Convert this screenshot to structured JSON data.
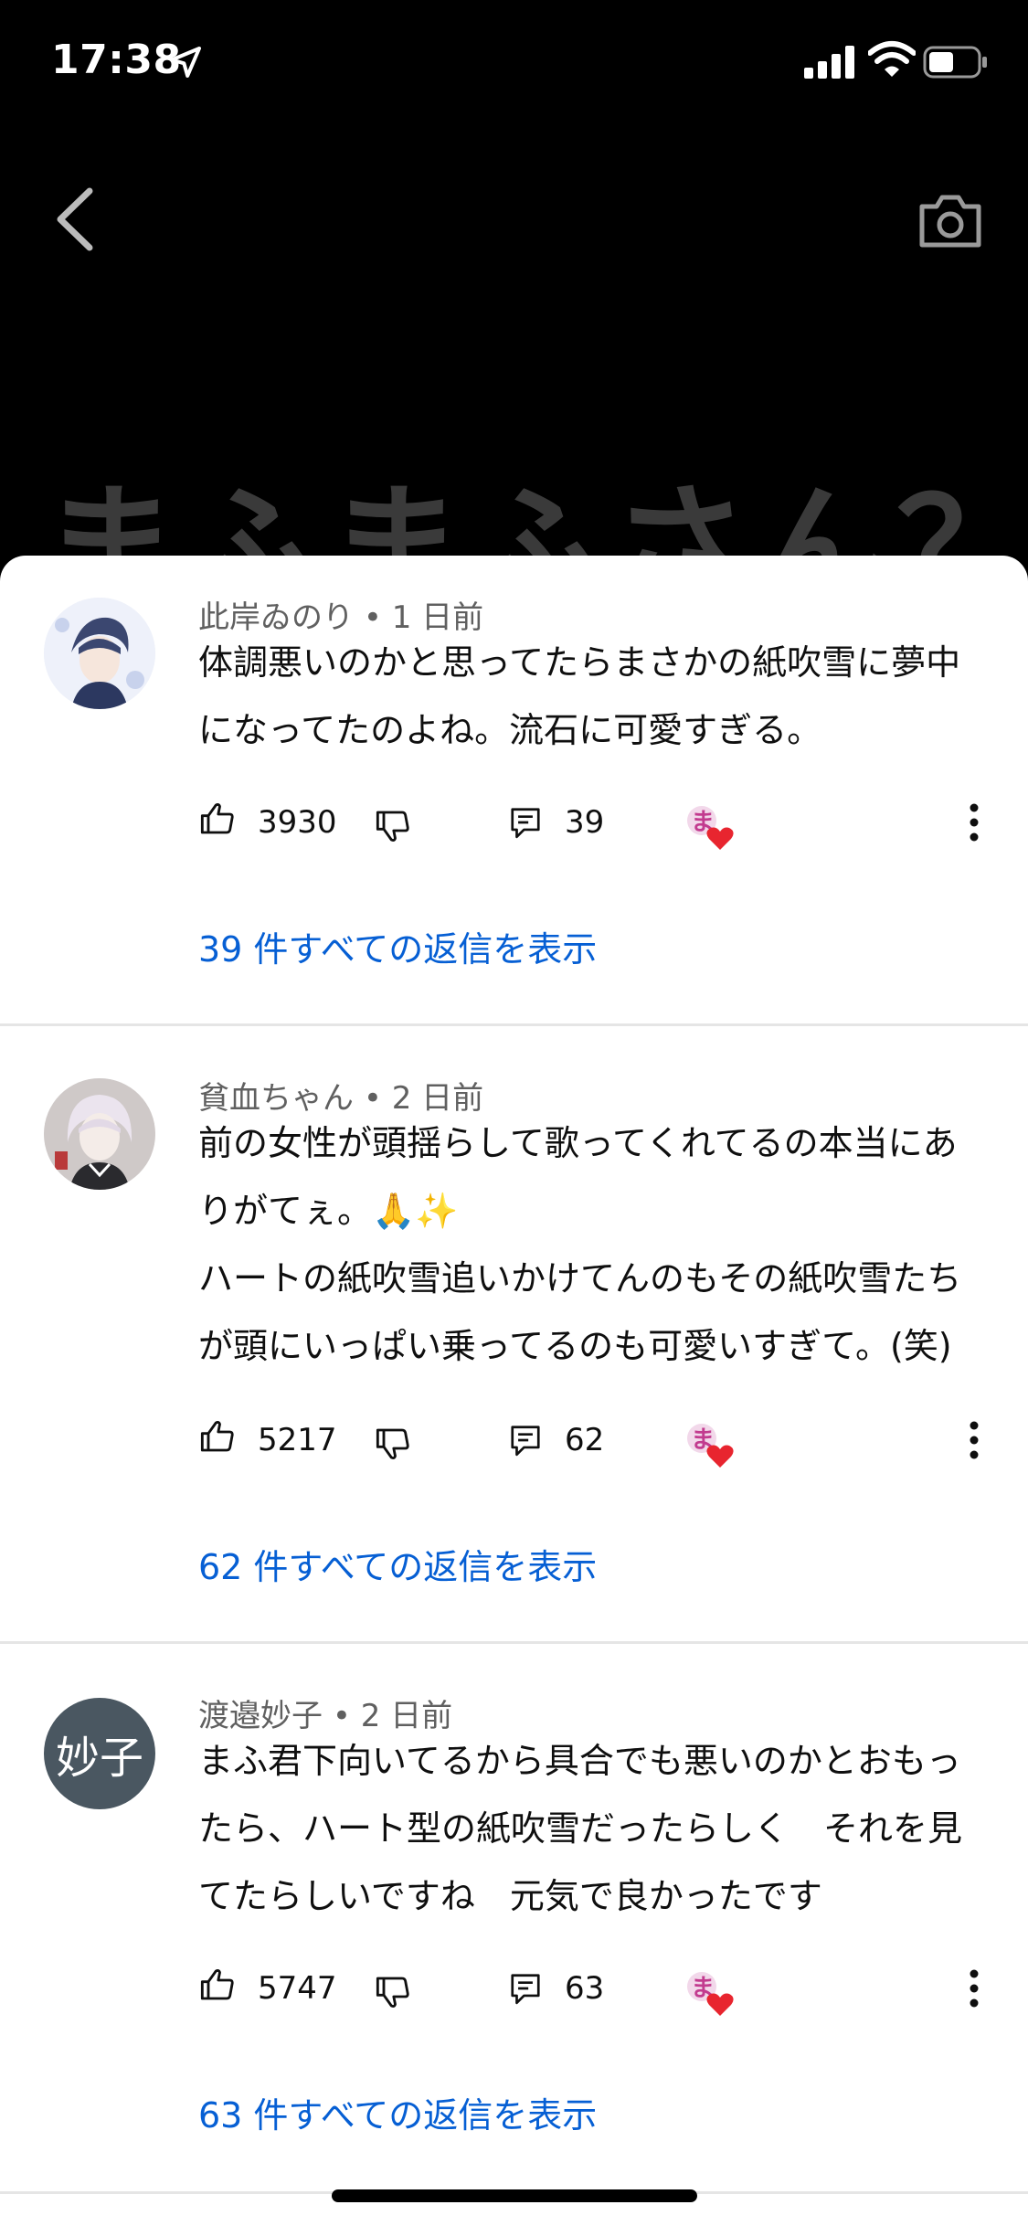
{
  "status_bar": {
    "time": "17:38"
  },
  "background_title": "まふまふさん？",
  "comments": [
    {
      "author": "此岸ゐのり",
      "age": "1 日前",
      "text": "体調悪いのかと思ってたらまさかの紙吹雪に夢中\nになってたのよね。流石に可愛すぎる。",
      "likes": "3930",
      "reply_count": "39",
      "replies_label": "39 件すべての返信を表示"
    },
    {
      "author": "貧血ちゃん",
      "age": "2 日前",
      "text": "前の女性が頭揺らして歌ってくれてるの本当にあ\nりがてぇ。🙏✨\nハートの紙吹雪追いかけてんのもその紙吹雪たち\nが頭にいっぱい乗ってるのも可愛いすぎて。(笑)",
      "likes": "5217",
      "reply_count": "62",
      "replies_label": "62 件すべての返信を表示"
    },
    {
      "author": "渡邉妙子",
      "age": "2 日前",
      "avatar_text": "妙子",
      "text": "まふ君下向いてるから具合でも悪いのかとおもっ\nたら、ハート型の紙吹雪だったらしく　それを見\nてたらしいですね　元気で良かったです",
      "likes": "5747",
      "reply_count": "63",
      "replies_label": "63 件すべての返信を表示"
    }
  ],
  "separator": "•",
  "colors": {
    "link": "#065fd4",
    "meta": "#606060",
    "heart": "#e8252f"
  },
  "icons": [
    "location-arrow-icon",
    "signal-icon",
    "wifi-icon",
    "battery-icon",
    "back-chevron-icon",
    "camera-icon",
    "like-icon",
    "dislike-icon",
    "reply-icon",
    "creator-heart-icon",
    "more-vert-icon"
  ]
}
